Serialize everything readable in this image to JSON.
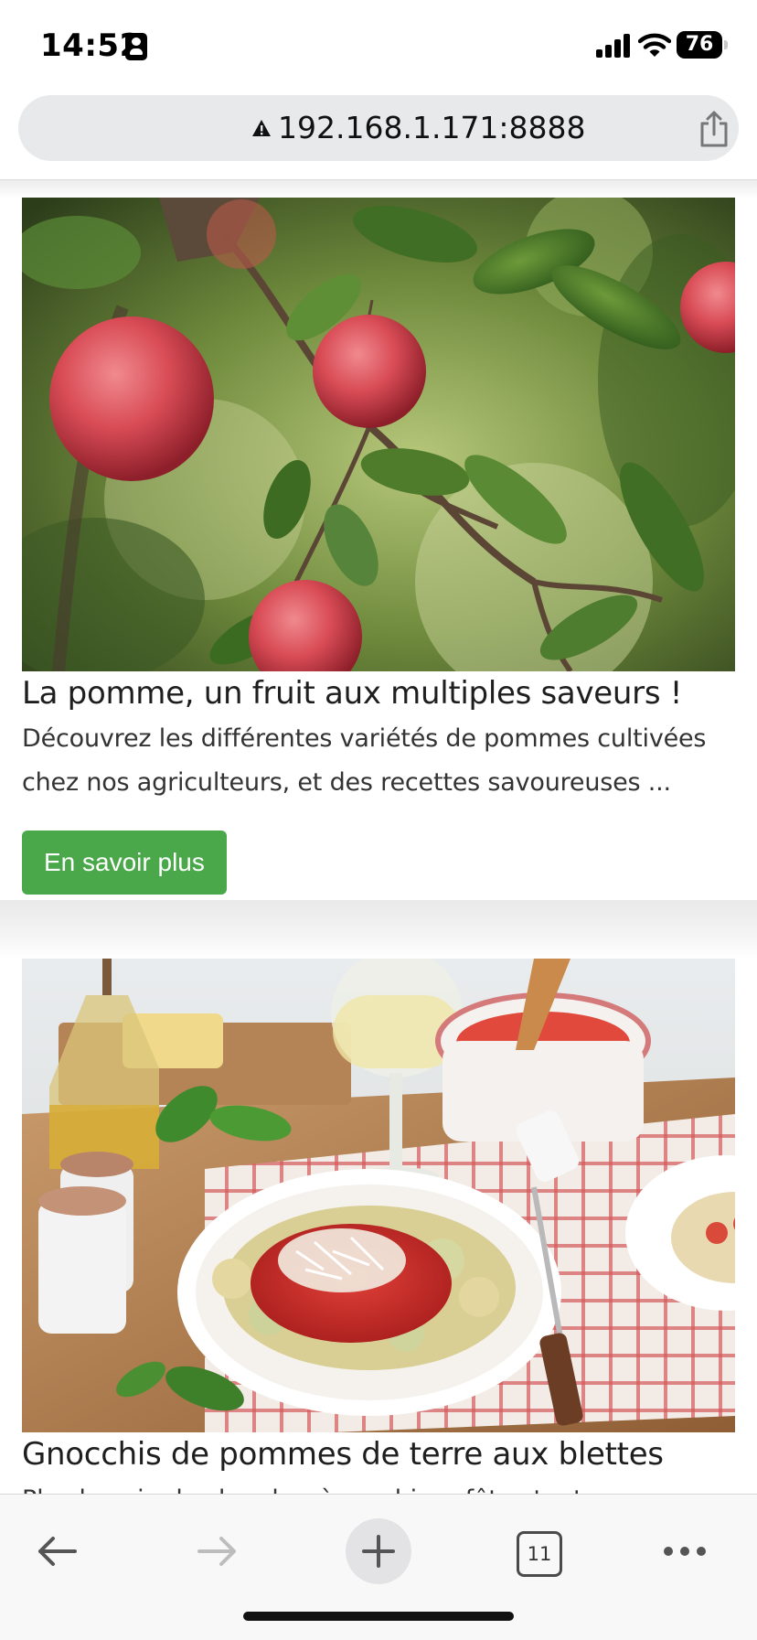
{
  "status_bar": {
    "time": "14:52",
    "battery_level": "76",
    "icons": [
      "focus-person-icon",
      "cellular-signal-icon",
      "wifi-icon",
      "battery-icon"
    ]
  },
  "browser": {
    "url": "192.168.1.171:8888",
    "security_icon": "warning-triangle-icon",
    "share_icon": "share-icon",
    "toolbar": {
      "back_icon": "back-arrow-icon",
      "forward_icon": "forward-arrow-icon",
      "new_tab_icon": "plus-icon",
      "tab_count": "11",
      "more_icon": "ellipsis-icon"
    }
  },
  "cards": [
    {
      "image": "apple-tree-photo",
      "title": "La pomme, un fruit aux multiples saveurs !",
      "description": "Découvrez les différentes variétés de pommes cultivées chez nos agriculteurs, et des recettes savoureuses ...",
      "button_label": "En savoir plus"
    },
    {
      "image": "gnocchi-dish-photo",
      "title": "Gnocchis de pommes de terre aux blettes",
      "description": "Plus besoin de chercher à combiner fêtes tout"
    }
  ],
  "colors": {
    "button_green": "#4aa84b",
    "url_pill": "#e8e9eb",
    "toolbar_bg": "#f8f8f8"
  }
}
